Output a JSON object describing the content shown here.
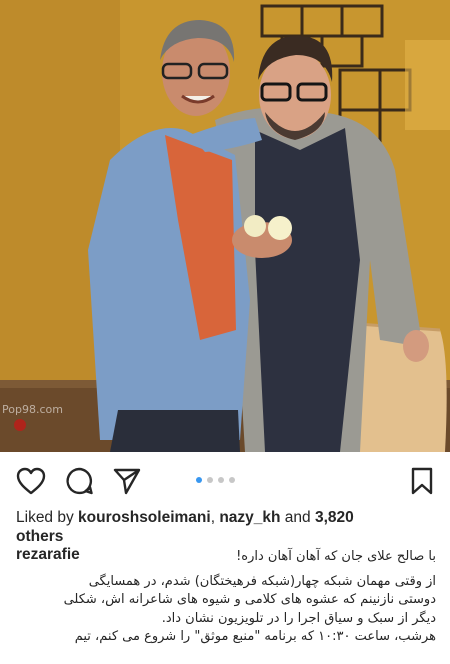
{
  "post": {
    "photo_alt": "two men posing in a TV studio",
    "watermark": "Pop98.com"
  },
  "actions": {
    "like_icon": "heart-icon",
    "comment_icon": "comment-icon",
    "share_icon": "paper-plane-icon",
    "save_icon": "bookmark-icon",
    "carousel_index": 1,
    "carousel_count": 4
  },
  "likes": {
    "prefix": "Liked by ",
    "user1": "kouroshsoleimani",
    "sep": ", ",
    "user2": "nazy_kh",
    "and": " and ",
    "count": "3,820",
    "others": "others"
  },
  "caption": {
    "username": "rezarafie",
    "line1": "با صالح علای جان که آهان آهان داره!",
    "line2": "از وقتی مهمان شبکه چهار(شبکه فرهیختگان) شدم، در همسایگی",
    "line3": "دوستی نازنینم که عشوه های کلامی و شیوه های شاعرانه اش، شکلی",
    "line4": "دیگر از سبک و سیاق اجرا را در تلویزیون نشان داد.",
    "line5": "هرشب، ساعت ۱۰:۳۰ که برنامه \"منبع موثق\" را شروع می کنم، تیم"
  }
}
